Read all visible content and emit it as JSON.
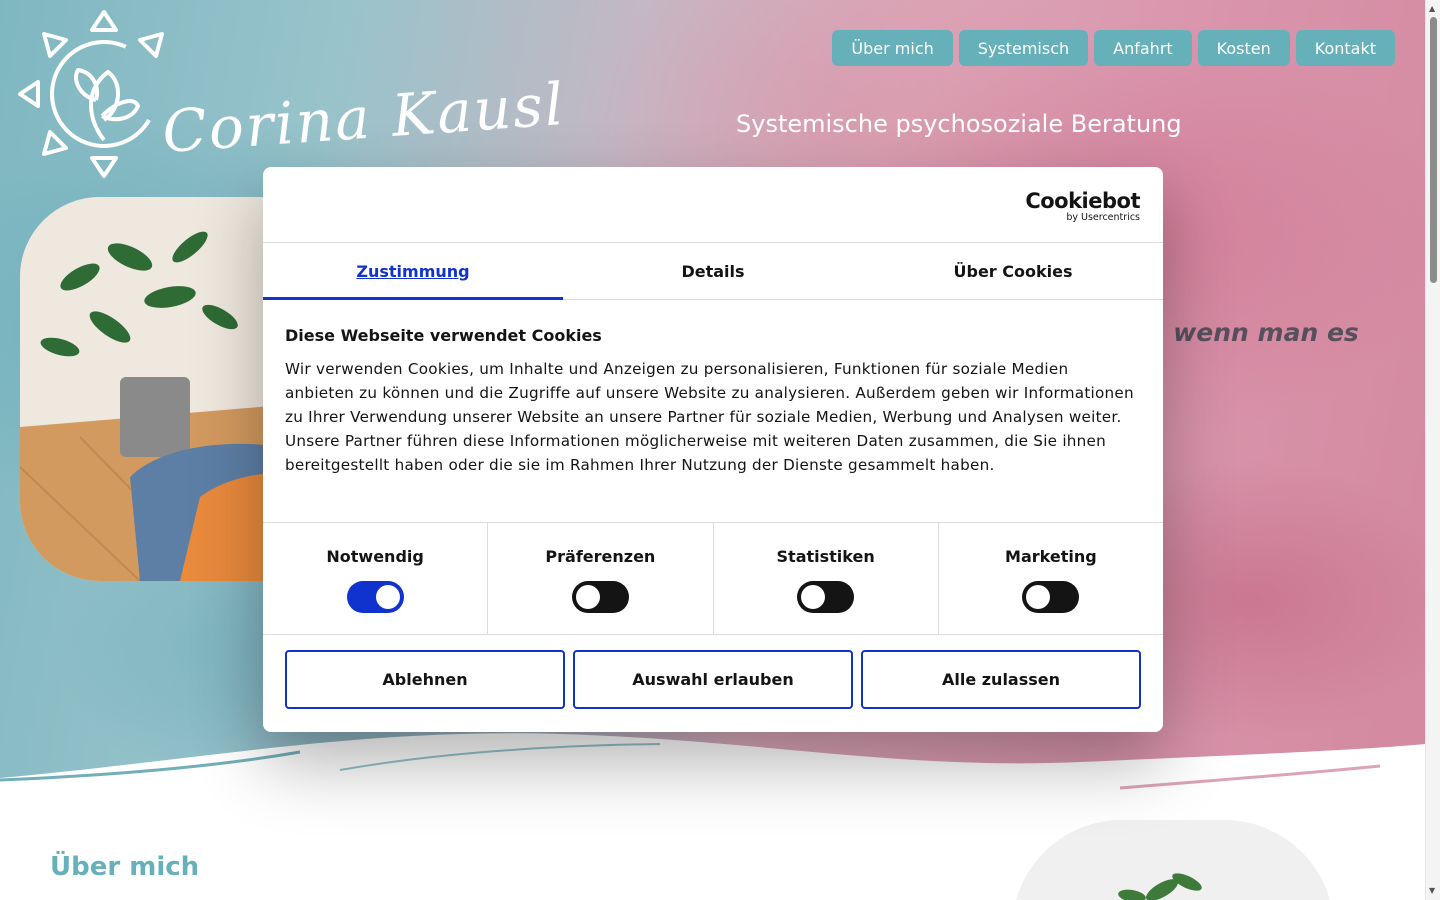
{
  "logo": {
    "script_text": "Corina Kausl",
    "icon": "sun-leaf-logo-icon"
  },
  "nav": {
    "items": [
      "Über mich",
      "Systemisch",
      "Anfahrt",
      "Kosten",
      "Kontakt"
    ],
    "button_color": "#66b0ba"
  },
  "hero": {
    "subtitle": "Systemische psychosoziale Beratung",
    "quote_fragment": ", wenn man es"
  },
  "below_hero": {
    "section_title": "Über mich"
  },
  "cookie_dialog": {
    "brand": "Cookiebot",
    "brand_sub": "by Usercentrics",
    "tabs": [
      "Zustimmung",
      "Details",
      "Über Cookies"
    ],
    "active_tab": "Zustimmung",
    "title": "Diese Webseite verwendet Cookies",
    "text": "Wir verwenden Cookies, um Inhalte und Anzeigen zu personalisieren, Funktionen für soziale Medien anbieten zu können und die Zugriffe auf unsere Website zu analysieren. Außerdem geben wir Informationen zu Ihrer Verwendung unserer Website an unsere Partner für soziale Medien, Werbung und Analysen weiter. Unsere Partner führen diese Informationen möglicherweise mit weiteren Daten zusammen, die Sie ihnen bereitgestellt haben oder die sie im Rahmen Ihrer Nutzung der Dienste gesammelt haben.",
    "toggles": [
      {
        "label": "Notwendig",
        "on": true
      },
      {
        "label": "Präferenzen",
        "on": false
      },
      {
        "label": "Statistiken",
        "on": false
      },
      {
        "label": "Marketing",
        "on": false
      }
    ],
    "buttons": {
      "decline": "Ablehnen",
      "allow_selection": "Auswahl erlauben",
      "allow_all": "Alle zulassen"
    },
    "accent_color": "#1032cf"
  }
}
